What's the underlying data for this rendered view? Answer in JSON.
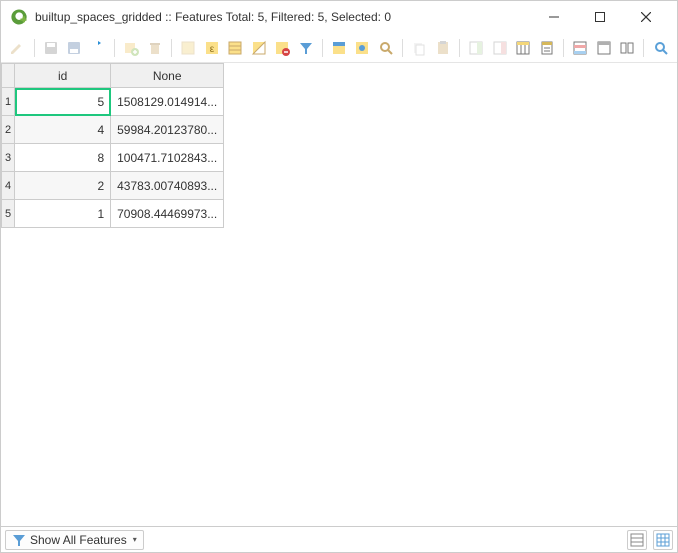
{
  "window": {
    "title": "builtup_spaces_gridded :: Features Total: 5, Filtered: 5, Selected: 0"
  },
  "table": {
    "columns": [
      "id",
      "None"
    ],
    "rows": [
      {
        "n": "1",
        "id": "5",
        "val": "1508129.014914...",
        "selected": true
      },
      {
        "n": "2",
        "id": "4",
        "val": "59984.20123780...",
        "selected": false
      },
      {
        "n": "3",
        "id": "8",
        "val": "100471.7102843...",
        "selected": false
      },
      {
        "n": "4",
        "id": "2",
        "val": "43783.00740893...",
        "selected": false
      },
      {
        "n": "5",
        "id": "1",
        "val": "70908.44469973...",
        "selected": false
      }
    ]
  },
  "statusbar": {
    "filter_label": "Show All Features"
  }
}
